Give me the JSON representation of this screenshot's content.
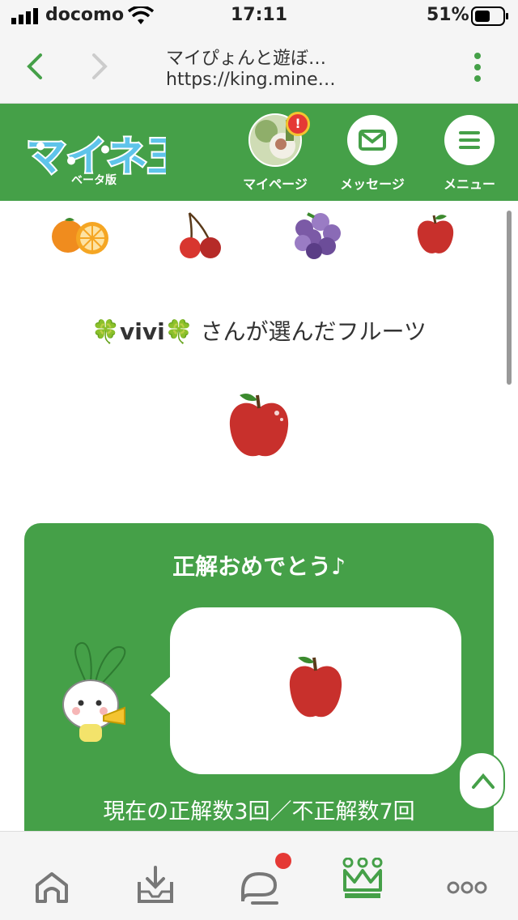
{
  "status_bar": {
    "carrier": "docomo",
    "time": "17:11",
    "battery": "51%"
  },
  "browser": {
    "page_title": "マイぴょんと遊ぼ…",
    "url": "https://king.mine…"
  },
  "header": {
    "logo_text": "マイネ王",
    "beta_label": "ベータ版",
    "nav": {
      "mypage": "マイページ",
      "message": "メッセージ",
      "menu": "メニュー"
    },
    "notification_badge": "!"
  },
  "fruits": [
    "orange",
    "cherry",
    "grape",
    "apple"
  ],
  "chosen": {
    "user_name": "🍀vivi🍀",
    "suffix": " さんが選んだフルーツ",
    "fruit": "apple"
  },
  "result_card": {
    "title": "正解おめでとう♪",
    "bubble_fruit": "apple",
    "score_text": "現在の正解数3回／不正解数7回"
  },
  "bottom_nav": [
    "home-icon",
    "upload-icon",
    "chat-icon",
    "king-icon",
    "more-icon"
  ],
  "colors": {
    "brand_green": "#45a048",
    "badge_red": "#e53935",
    "apple_red": "#c8302c"
  }
}
